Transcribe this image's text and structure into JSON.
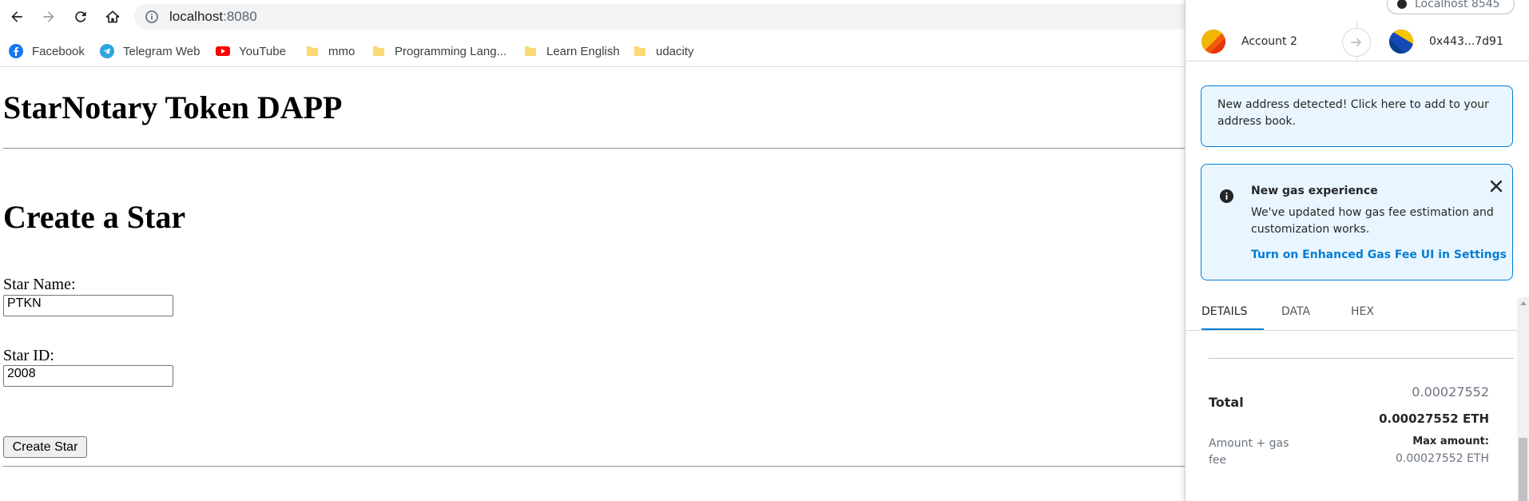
{
  "browser": {
    "url_host": "localhost",
    "url_port": ":8080",
    "bookmarks": [
      {
        "label": "Facebook",
        "icon": "facebook-icon"
      },
      {
        "label": "Telegram Web",
        "icon": "telegram-icon"
      },
      {
        "label": "YouTube",
        "icon": "youtube-icon"
      },
      {
        "label": "mmo",
        "icon": "folder-icon"
      },
      {
        "label": "Programming Lang...",
        "icon": "folder-icon"
      },
      {
        "label": "Learn English",
        "icon": "folder-icon"
      },
      {
        "label": "udacity",
        "icon": "folder-icon"
      }
    ]
  },
  "page": {
    "title": "StarNotary Token DAPP",
    "section_title": "Create a Star",
    "star_name_label": "Star Name:",
    "star_name_value": "PTKN",
    "star_id_label": "Star ID:",
    "star_id_value": "2008",
    "create_button": "Create Star"
  },
  "metamask": {
    "network": "Localhost 8545",
    "from_account": "Account 2",
    "to_address": "0x443...7d91",
    "notice": "New address detected! Click here to add to your address book.",
    "gas_card": {
      "title": "New gas experience",
      "body": "We've updated how gas fee estimation and customization works.",
      "link": "Turn on Enhanced Gas Fee UI in Settings"
    },
    "tabs": [
      "DETAILS",
      "DATA",
      "HEX"
    ],
    "total_label": "Total",
    "total_primary": "0.00027552",
    "total_eth": "0.00027552 ETH",
    "amount_gas_label": "Amount + gas fee",
    "max_amount_label": "Max amount:",
    "max_amount_value": "0.00027552 ETH"
  },
  "colors": {
    "accent": "#037dd6",
    "notice_bg": "#eaf6ff"
  }
}
